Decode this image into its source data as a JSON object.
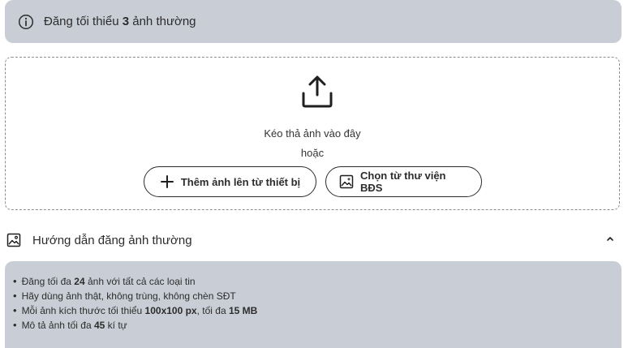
{
  "notice": {
    "icon": "info-icon",
    "text_before": "Đăng tối thiểu ",
    "count": "3",
    "text_after": " ảnh thường"
  },
  "upload": {
    "icon": "upload-icon",
    "drag_text": "Kéo thả ảnh vào đây",
    "or_text": "hoặc",
    "device_button": "Thêm ảnh lên từ thiết bị",
    "library_button": "Chọn từ thư viện BĐS"
  },
  "guide": {
    "icon": "image-icon",
    "title": "Hướng dẫn đăng ảnh thường",
    "chevron": "chevron-up-icon",
    "items": [
      {
        "a": "Đăng tối đa ",
        "b": "24",
        "c": " ảnh với tất cả các loại tin"
      },
      {
        "a": "Hãy dùng ảnh thật, không trùng, không chèn SĐT"
      },
      {
        "a": "Mỗi ảnh kích thước tối thiểu ",
        "b": "100x100 px",
        "c": ", tối đa ",
        "d": "15 MB"
      },
      {
        "a": "Mô tả ảnh tối đa ",
        "b": "45",
        "c": " kí tự"
      }
    ]
  }
}
